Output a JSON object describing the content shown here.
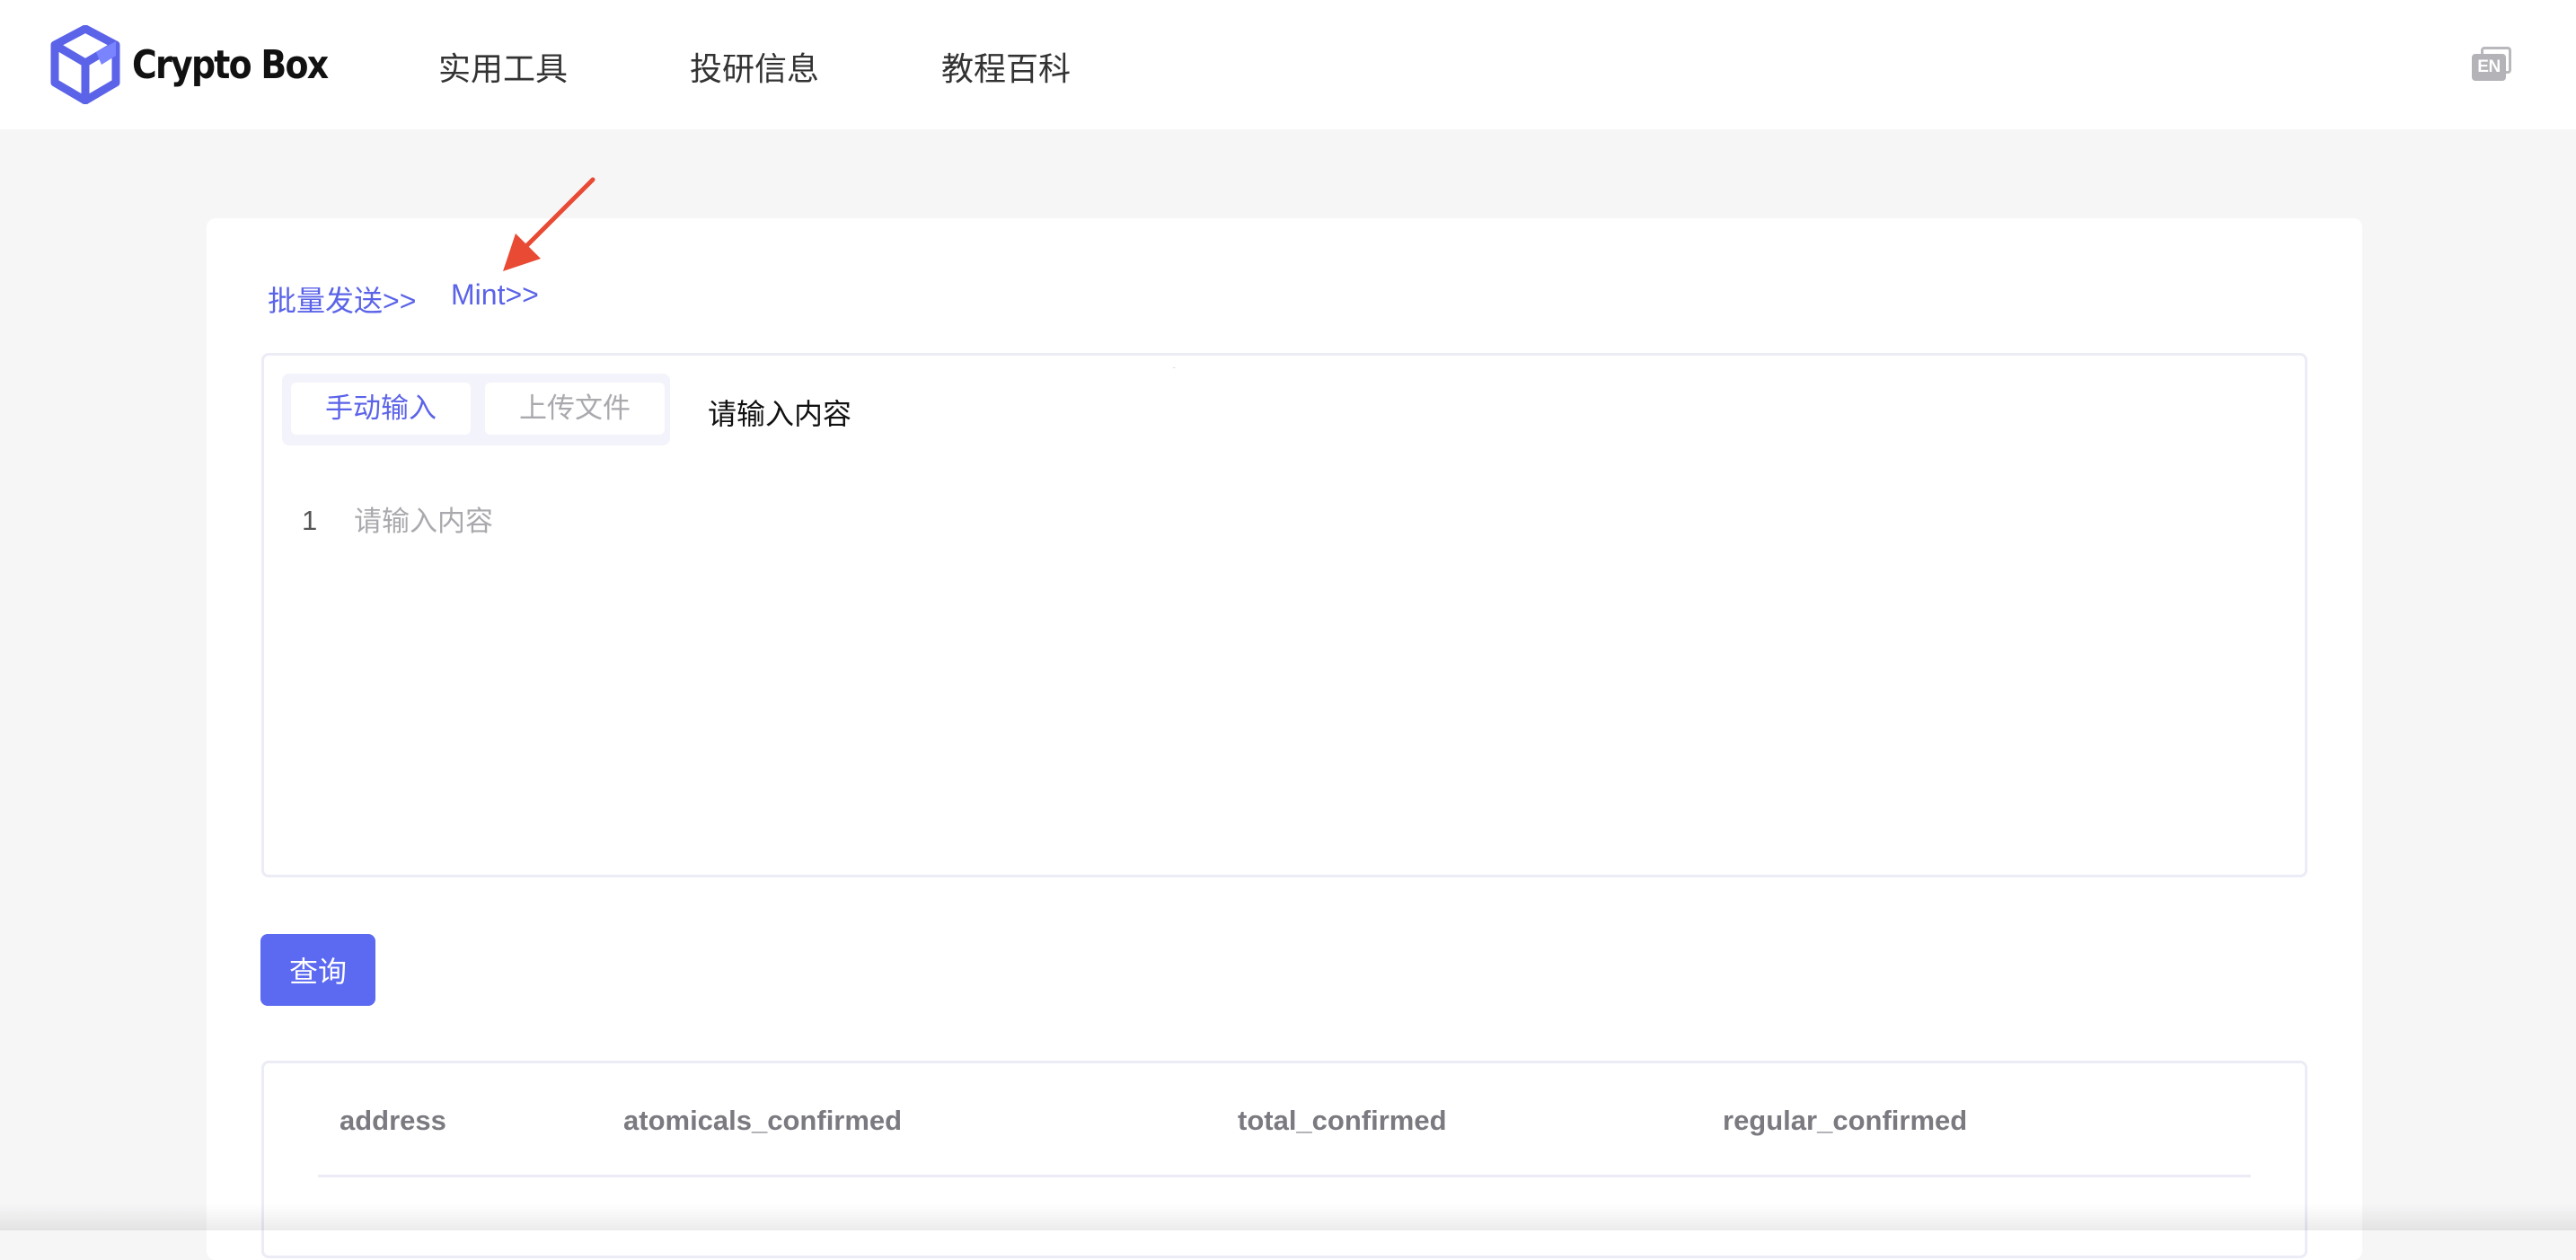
{
  "header": {
    "logo_text": "Crypto Box",
    "nav": [
      {
        "label": "实用工具"
      },
      {
        "label": "投研信息"
      },
      {
        "label": "教程百科"
      }
    ],
    "lang_toggle": "EN"
  },
  "links": {
    "batch_send": "批量发送>>",
    "mint": "Mint>>"
  },
  "editor": {
    "tabs": [
      {
        "label": "手动输入",
        "active": true
      },
      {
        "label": "上传文件",
        "active": false
      }
    ],
    "hint": "请输入内容",
    "line_number": "1",
    "placeholder": "请输入内容",
    "value": ""
  },
  "query_button": "查询",
  "table": {
    "columns": [
      "address",
      "atomicals_confirmed",
      "total_confirmed",
      "regular_confirmed"
    ]
  },
  "colors": {
    "accent": "#5b63e8",
    "button": "#5b6af0",
    "annotation_arrow": "#e84a34"
  },
  "icons": {
    "logo": "cube-logo-icon",
    "lang": "language-toggle-icon",
    "annotation": "red-arrow-icon"
  }
}
